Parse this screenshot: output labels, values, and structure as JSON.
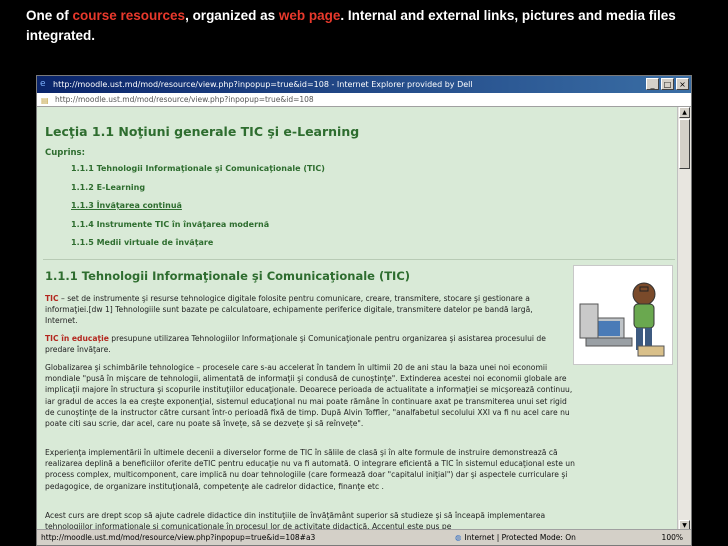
{
  "caption": {
    "part1": "One of ",
    "hl1": "course resources",
    "part2": ", organized as ",
    "hl2": "web page",
    "part3": ". Internal and external links, pictures and media files integrated."
  },
  "window": {
    "title": "http://moodle.ust.md/mod/resource/view.php?inpopup=true&id=108 - Internet Explorer provided by Dell",
    "address": "http://moodle.ust.md/mod/resource/view.php?inpopup=true&id=108",
    "status_url": "http://moodle.ust.md/mod/resource/view.php?inpopup=true&id=108#a3",
    "status_zone": "Internet | Protected Mode: On",
    "zoom": "100%"
  },
  "lesson": {
    "title": "Lecţia 1.1 Noţiuni generale TIC şi e-Learning",
    "contents_label": "Cuprins:",
    "toc": [
      "1.1.1 Tehnologii Informaţionale şi Comunicaţionale (TIC)",
      "1.1.2 E-Learning",
      "1.1.3 Învăţarea continuă",
      "1.1.4 Instrumente TIC în învăţarea modernă",
      "1.1.5 Medii virtuale de învăţare"
    ],
    "section_title": "1.1.1 Tehnologii Informaţionale şi Comunicaţionale (TIC)",
    "p1_kw": "TIC",
    "p1": " – set de instrumente şi resurse tehnologice digitale folosite pentru comunicare, creare, transmitere, stocare şi gestionare a informaţiei.[dw 1] Tehnologiile sunt bazate pe calculatoare, echipamente periferice digitale, transmitere datelor pe bandă largă, Internet.",
    "p2_kw": "TIC în educaţie",
    "p2": " presupune utilizarea Tehnologiilor Informaţionale şi Comunicaţionale pentru organizarea şi asistarea procesului de predare învăţare.",
    "p3": "Globalizarea şi schimbările tehnologice – procesele care s-au accelerat în tandem în ultimii 20 de ani stau la baza unei noi economii mondiale \"pusă în mişcare de tehnologii, alimentată de informaţii şi condusă de cunoştinţe\". Extinderea acestei noi economii globale are implicaţii majore în structura şi scopurile instituţiilor educaţionale. Deoarece perioada de actualitate a informaţiei se micşorează continuu, iar gradul de acces la ea creşte exponenţial, sistemul educaţional nu mai poate rămâne în continuare axat pe transmiterea unui set rigid de cunoştinţe de la instructor către cursant într-o perioadă fixă de timp. După Alvin Toffler, \"analfabetul secolului XXI va fi nu acel care nu poate citi sau scrie, dar acel, care nu poate să învețe, să se dezvețe şi să reînvețe\".",
    "p4": "Experienţa implementării în ultimele decenii a diverselor forme de TIC în sălile de clasă şi în alte formule de instruire demonstrează că realizarea deplină a beneficiilor oferite deTIC pentru educaţie nu va fi automată. O integrare eficientă a TIC în sistemul educaţional este un process complex, multicomponent, care implică nu doar tehnologiile (care formează doar \"capitalul iniţial\") dar şi aspectele curriculare şi pedagogice, de organizare instituţională, competenţe ale cadrelor didactice, finanţe etc .",
    "p5": "Acest curs are drept scop să ajute cadrele didactice din instituţiile de învăţământ superior să studieze şi să înceapă implementarea tehnologiilor informaţionale şi comunicaţionale în procesul lor de activitate didactică. Accentul este pus pe"
  },
  "colors": {
    "accent_red": "#e8392c",
    "heading_green": "#2e6d2f",
    "page_bg": "#d9ead7"
  }
}
